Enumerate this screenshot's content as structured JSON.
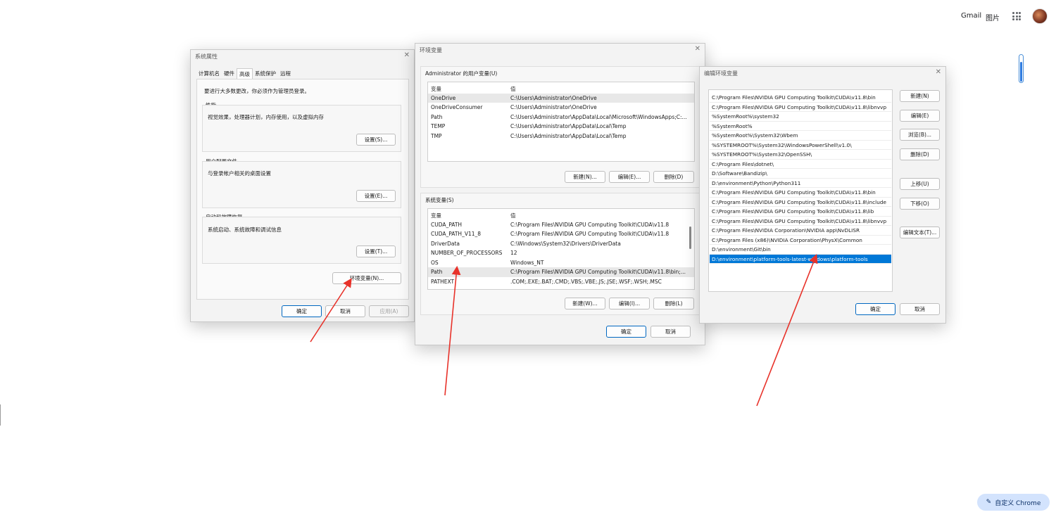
{
  "chrome": {
    "gmail": "Gmail",
    "images": "图片",
    "customize": "自定义 Chrome"
  },
  "sysprops": {
    "title": "系统属性",
    "tabs": [
      "计算机名",
      "硬件",
      "高级",
      "系统保护",
      "远程"
    ],
    "active_tab": 2,
    "admin_note": "要进行大多数更改，你必须作为管理员登录。",
    "perf_label": "性能",
    "perf_desc": "视觉效果，处理器计划，内存使用，以及虚拟内存",
    "perf_btn": "设置(S)...",
    "profile_label": "用户配置文件",
    "profile_desc": "与登录帐户相关的桌面设置",
    "profile_btn": "设置(E)...",
    "startup_label": "启动和故障恢复",
    "startup_desc": "系统启动、系统故障和调试信息",
    "startup_btn": "设置(T)...",
    "env_btn": "环境变量(N)...",
    "ok": "确定",
    "cancel": "取消",
    "apply": "应用(A)"
  },
  "envvars": {
    "title": "环境变量",
    "user_label": "Administrator 的用户变量(U)",
    "col_var": "变量",
    "col_val": "值",
    "user_rows": [
      {
        "name": "OneDrive",
        "value": "C:\\Users\\Administrator\\OneDrive"
      },
      {
        "name": "OneDriveConsumer",
        "value": "C:\\Users\\Administrator\\OneDrive"
      },
      {
        "name": "Path",
        "value": "C:\\Users\\Administrator\\AppData\\Local\\Microsoft\\WindowsApps;C:..."
      },
      {
        "name": "TEMP",
        "value": "C:\\Users\\Administrator\\AppData\\Local\\Temp"
      },
      {
        "name": "TMP",
        "value": "C:\\Users\\Administrator\\AppData\\Local\\Temp"
      }
    ],
    "user_new": "新建(N)...",
    "user_edit": "编辑(E)...",
    "user_delete": "删除(D)",
    "sys_label": "系统变量(S)",
    "sys_rows": [
      {
        "name": "CUDA_PATH",
        "value": "C:\\Program Files\\NVIDIA GPU Computing Toolkit\\CUDA\\v11.8"
      },
      {
        "name": "CUDA_PATH_V11_8",
        "value": "C:\\Program Files\\NVIDIA GPU Computing Toolkit\\CUDA\\v11.8"
      },
      {
        "name": "DriverData",
        "value": "C:\\Windows\\System32\\Drivers\\DriverData"
      },
      {
        "name": "NUMBER_OF_PROCESSORS",
        "value": "12"
      },
      {
        "name": "OS",
        "value": "Windows_NT"
      },
      {
        "name": "Path",
        "value": "C:\\Program Files\\NVIDIA GPU Computing Toolkit\\CUDA\\v11.8\\bin;..."
      },
      {
        "name": "PATHEXT",
        "value": ".COM;.EXE;.BAT;.CMD;.VBS;.VBE;.JS;.JSE;.WSF;.WSH;.MSC"
      }
    ],
    "sys_new": "新建(W)...",
    "sys_edit": "编辑(I)...",
    "sys_delete": "删除(L)",
    "ok": "确定",
    "cancel": "取消"
  },
  "editenv": {
    "title": "编辑环境变量",
    "paths": [
      "C:\\Program Files\\NVIDIA GPU Computing Toolkit\\CUDA\\v11.8\\bin",
      "C:\\Program Files\\NVIDIA GPU Computing Toolkit\\CUDA\\v11.8\\libnvvp",
      "%SystemRoot%\\system32",
      "%SystemRoot%",
      "%SystemRoot%\\System32\\Wbem",
      "%SYSTEMROOT%\\System32\\WindowsPowerShell\\v1.0\\",
      "%SYSTEMROOT%\\System32\\OpenSSH\\",
      "C:\\Program Files\\dotnet\\",
      "D:\\Software\\Bandizip\\",
      "D:\\environment\\Python\\Python311",
      "C:\\Program Files\\NVIDIA GPU Computing Toolkit\\CUDA\\v11.8\\bin",
      "C:\\Program Files\\NVIDIA GPU Computing Toolkit\\CUDA\\v11.8\\include",
      "C:\\Program Files\\NVIDIA GPU Computing Toolkit\\CUDA\\v11.8\\lib",
      "C:\\Program Files\\NVIDIA GPU Computing Toolkit\\CUDA\\v11.8\\libnvvp",
      "C:\\Program Files\\NVIDIA Corporation\\NVIDIA app\\NvDLISR",
      "C:\\Program Files (x86)\\NVIDIA Corporation\\PhysX\\Common",
      "D:\\environment\\Git\\bin",
      "D:\\environment\\platform-tools-latest-windows\\platform-tools"
    ],
    "selected_index": 17,
    "btn_new": "新建(N)",
    "btn_edit": "编辑(E)",
    "btn_browse": "浏览(B)...",
    "btn_delete": "删除(D)",
    "btn_up": "上移(U)",
    "btn_down": "下移(O)",
    "btn_edit_text": "编辑文本(T)...",
    "ok": "确定",
    "cancel": "取消"
  },
  "colors": {
    "arrow": "#e8322a",
    "selection": "#0078d7"
  }
}
